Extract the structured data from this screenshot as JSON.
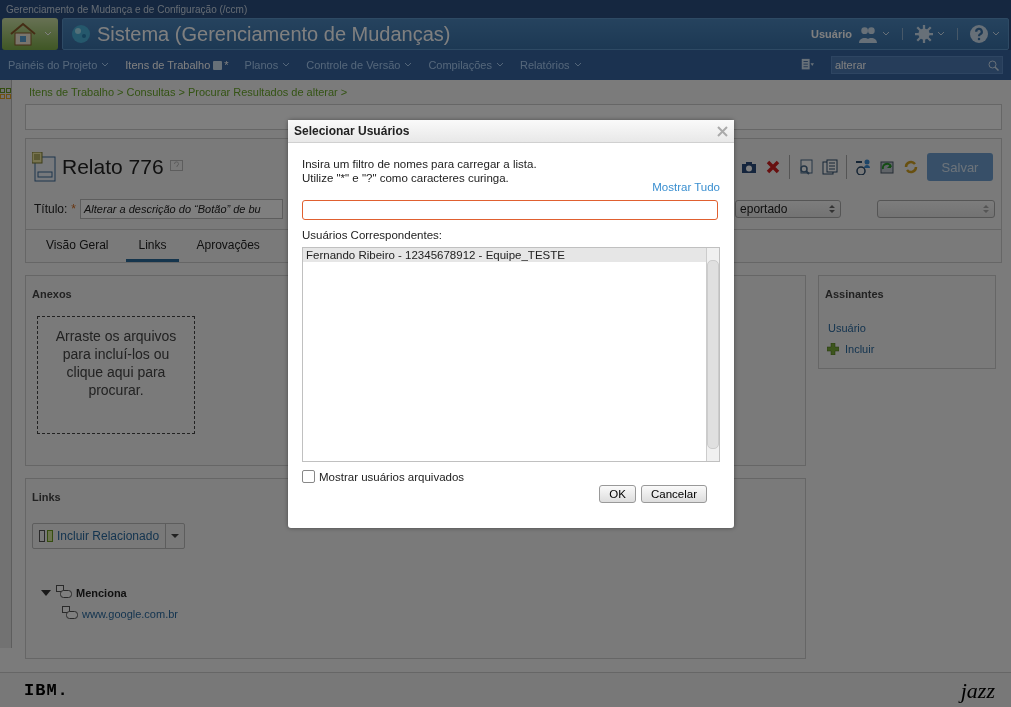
{
  "app_title": "Gerenciamento de Mudança e de Configuração (/ccm)",
  "project_title": "Sistema (Gerenciamento de Mudanças)",
  "user_menu": "Usuário",
  "nav": [
    {
      "label": "Painéis do Projeto",
      "selected": false
    },
    {
      "label": "Itens de Trabalho",
      "selected": true,
      "suffix": "*"
    },
    {
      "label": "Planos",
      "selected": false
    },
    {
      "label": "Controle de Versão",
      "selected": false
    },
    {
      "label": "Compilações",
      "selected": false
    },
    {
      "label": "Relatórios",
      "selected": false
    }
  ],
  "search": {
    "value": "alterar"
  },
  "breadcrumb": "Itens de Trabalho > Consultas > Procurar Resultados de alterar >",
  "work_item": {
    "title": "Relato 776",
    "title_label": "Título:",
    "required_mark": "*",
    "title_value": "Alterar a descrição do “Botão” de bu",
    "status": "eportado",
    "save_button": "Salvar"
  },
  "tabs": [
    {
      "label": "Visão Geral",
      "selected": false
    },
    {
      "label": "Links",
      "selected": true
    },
    {
      "label": "Aprovações",
      "selected": false
    }
  ],
  "attachments": {
    "heading": "Anexos",
    "drop_text": "Arraste os arquivos para incluí-los ou clique aqui para procurar."
  },
  "links": {
    "heading": "Links",
    "add_button": "Incluir Relacionado",
    "groups": [
      {
        "label": "Menciona",
        "expanded": true,
        "children": [
          {
            "label": "www.google.com.br"
          }
        ]
      }
    ]
  },
  "subscribers": {
    "heading": "Assinantes",
    "items": [
      "Usuário"
    ],
    "add": "Incluir"
  },
  "dialog": {
    "title": "Selecionar Usuários",
    "instructions": [
      "Insira um filtro de nomes para carregar a lista.",
      "Utilize \"*\" e \"?\" como caracteres curinga."
    ],
    "show_all": "Mostrar Tudo",
    "results_label": "Usuários Correspondentes:",
    "results": [
      {
        "label": "Fernando Ribeiro - 12345678912 - Equipe_TESTE",
        "selected": true
      }
    ],
    "show_archived": {
      "label": "Mostrar usuários arquivados",
      "checked": false
    },
    "buttons": [
      "OK",
      "Cancelar"
    ]
  },
  "footer": {
    "left_logo": "IBM.",
    "right_logo": "jazz"
  }
}
